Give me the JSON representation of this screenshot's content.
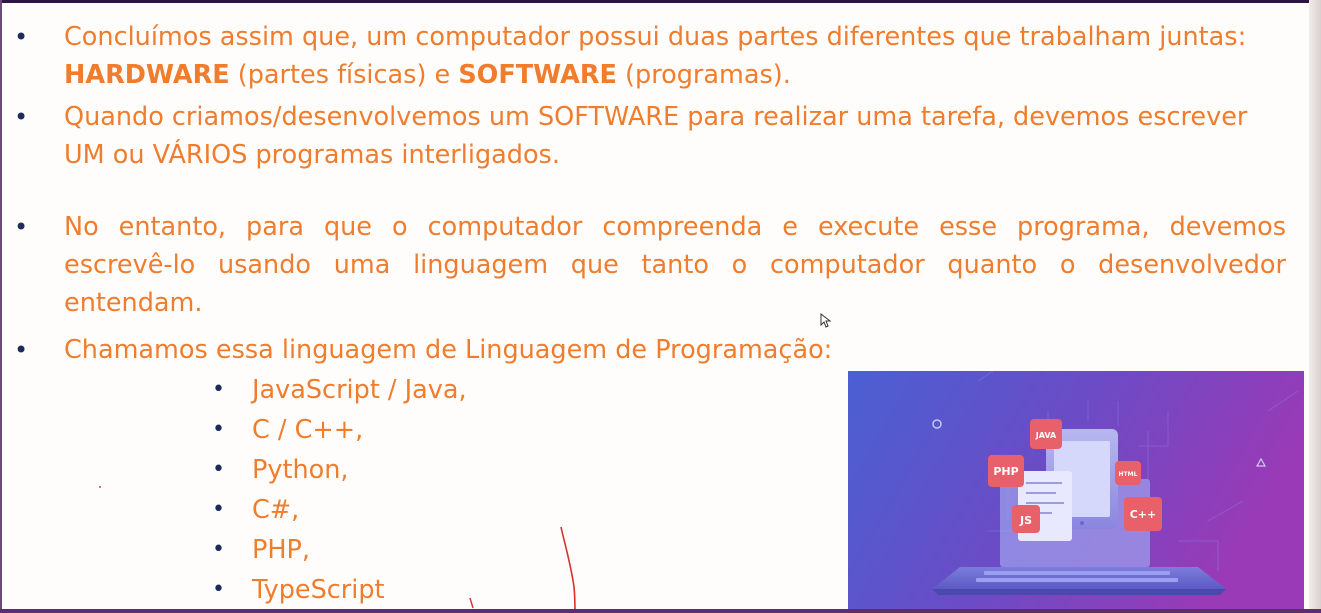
{
  "slide": {
    "bullets": [
      {
        "line1": "Concluímos assim que, um computador possui duas partes diferentes que trabalham juntas:",
        "line2_bold1": "HARDWARE",
        "line2_text1": " (partes físicas) e ",
        "line2_bold2": "SOFTWARE",
        "line2_text2": " (programas)."
      },
      {
        "line1": "Quando criamos/desenvolvemos um SOFTWARE para realizar uma tarefa, devemos escrever",
        "line2": "UM ou VÁRIOS programas interligados."
      },
      {
        "text": "No entanto, para que o computador compreenda e execute esse programa, devemos escrevê-lo usando uma linguagem que tanto o computador quanto o desenvolvedor entendam."
      },
      {
        "text": "Chamamos essa linguagem de Linguagem de Programação:"
      }
    ],
    "languages": [
      "JavaScript / Java,",
      "C / C++,",
      "Python,",
      "C#,",
      "PHP,",
      "TypeScript"
    ],
    "illustration": {
      "tags": [
        "JAVA",
        "PHP",
        "HTML",
        "JS",
        "C++"
      ]
    }
  },
  "colors": {
    "text": "#ef7d2d",
    "bullet": "#1f2b5c",
    "background": "#fffdfb",
    "illustration_start": "#4a5fd0",
    "illustration_end": "#8e3ab8",
    "tag": "#e8606a"
  }
}
